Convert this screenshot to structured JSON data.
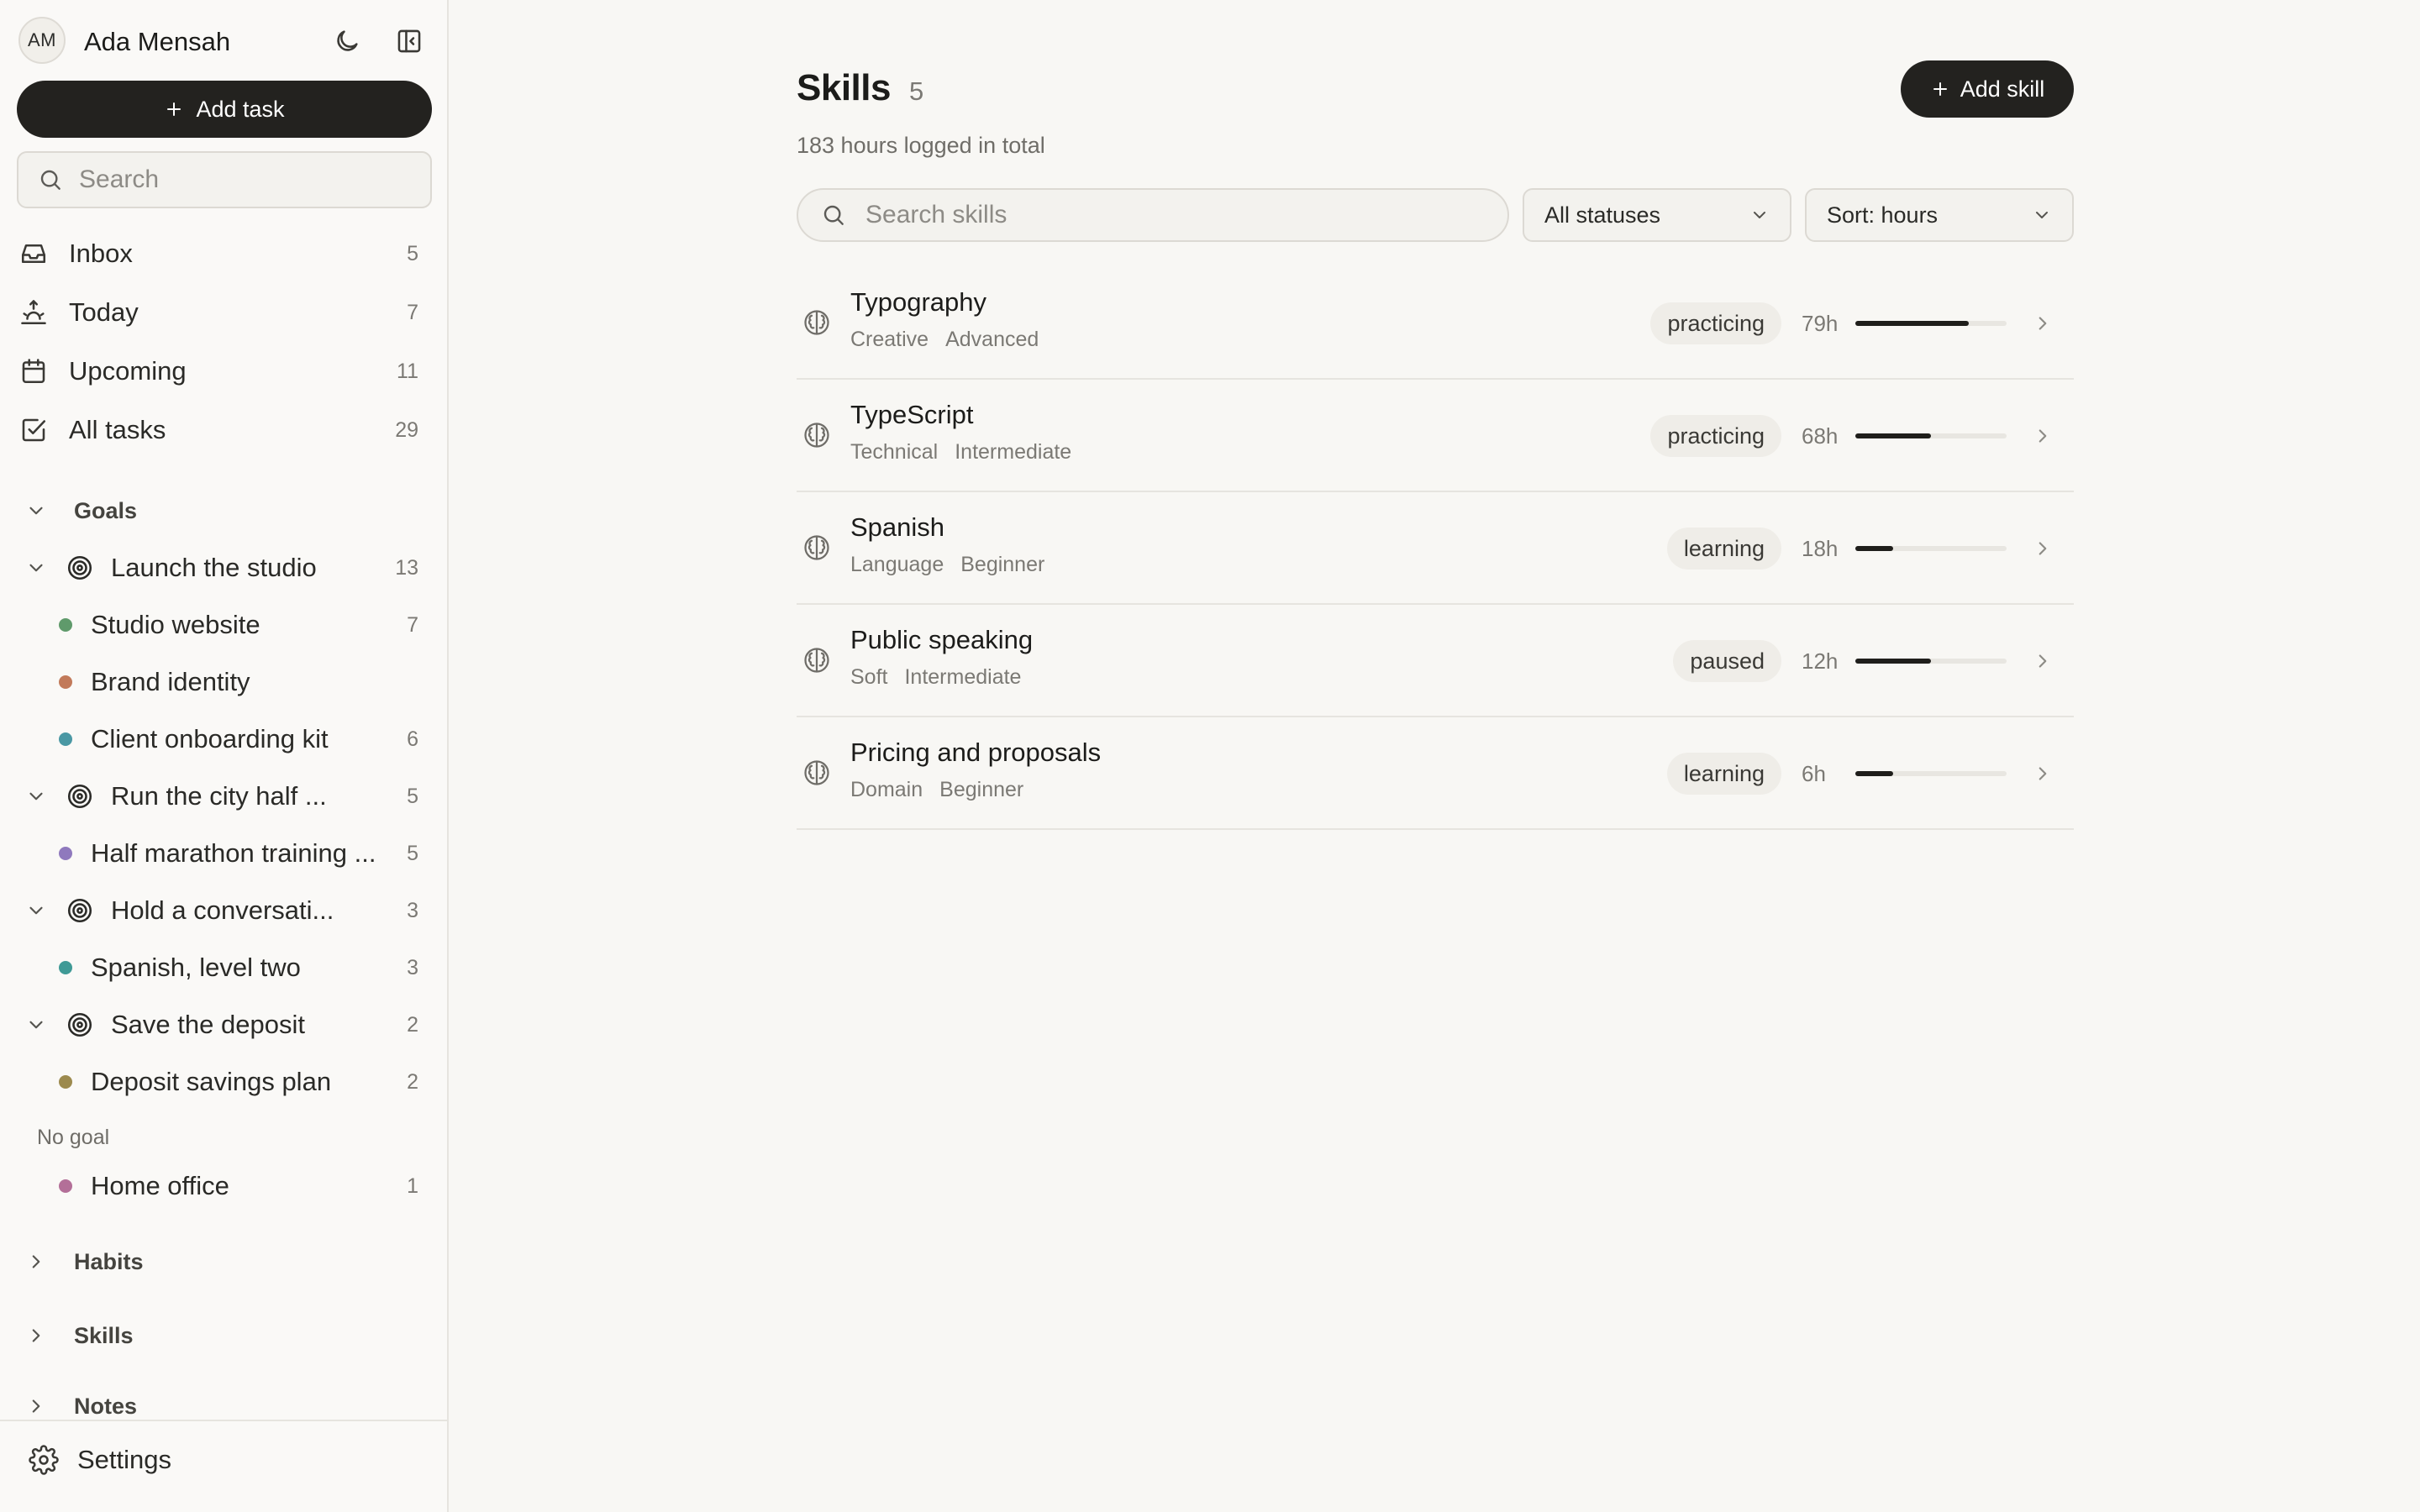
{
  "user": {
    "initials": "AM",
    "name": "Ada Mensah"
  },
  "sidebar": {
    "add_task_label": "Add task",
    "search_placeholder": "Search",
    "nav": [
      {
        "label": "Inbox",
        "count": "5",
        "icon": "inbox-icon"
      },
      {
        "label": "Today",
        "count": "7",
        "icon": "sunrise-icon"
      },
      {
        "label": "Upcoming",
        "count": "11",
        "icon": "calendar-icon"
      },
      {
        "label": "All tasks",
        "count": "29",
        "icon": "checkbox-icon"
      }
    ],
    "goals_label": "Goals",
    "goals": [
      {
        "label": "Launch the studio",
        "count": "13",
        "projects": [
          {
            "label": "Studio website",
            "count": "7",
            "color": "#5f9a6b"
          },
          {
            "label": "Brand identity",
            "count": "",
            "color": "#c27a5a"
          },
          {
            "label": "Client onboarding kit",
            "count": "6",
            "color": "#4a98a4"
          }
        ]
      },
      {
        "label": "Run the city half ...",
        "count": "5",
        "projects": [
          {
            "label": "Half marathon training ...",
            "count": "5",
            "color": "#8f79bd"
          }
        ]
      },
      {
        "label": "Hold a conversati...",
        "count": "3",
        "projects": [
          {
            "label": "Spanish, level two",
            "count": "3",
            "color": "#3f9a96"
          }
        ]
      },
      {
        "label": "Save the deposit",
        "count": "2",
        "projects": [
          {
            "label": "Deposit savings plan",
            "count": "2",
            "color": "#9c8a4e"
          }
        ]
      }
    ],
    "no_goal_label": "No goal",
    "no_goal_projects": [
      {
        "label": "Home office",
        "count": "1",
        "color": "#b36f98"
      }
    ],
    "habits_label": "Habits",
    "skills_label": "Skills",
    "notes_label": "Notes",
    "settings_label": "Settings"
  },
  "main": {
    "title": "Skills",
    "count": "5",
    "subtitle": "183 hours logged in total",
    "add_skill_label": "Add skill",
    "search_placeholder": "Search skills",
    "status_filter": "All statuses",
    "sort": "Sort: hours",
    "skills": [
      {
        "name": "Typography",
        "category": "Creative",
        "level": "Advanced",
        "status": "practicing",
        "hours": "79h",
        "progress": 0.75
      },
      {
        "name": "TypeScript",
        "category": "Technical",
        "level": "Intermediate",
        "status": "practicing",
        "hours": "68h",
        "progress": 0.5
      },
      {
        "name": "Spanish",
        "category": "Language",
        "level": "Beginner",
        "status": "learning",
        "hours": "18h",
        "progress": 0.25
      },
      {
        "name": "Public speaking",
        "category": "Soft",
        "level": "Intermediate",
        "status": "paused",
        "hours": "12h",
        "progress": 0.5
      },
      {
        "name": "Pricing and proposals",
        "category": "Domain",
        "level": "Beginner",
        "status": "learning",
        "hours": "6h",
        "progress": 0.25
      }
    ]
  }
}
